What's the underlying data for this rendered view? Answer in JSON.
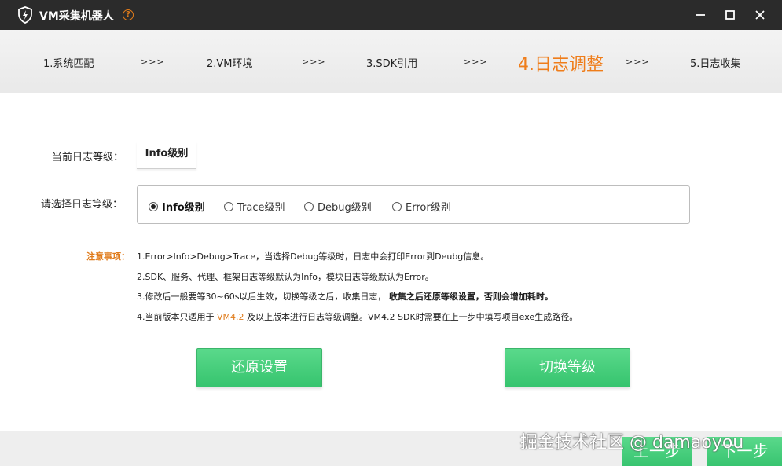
{
  "window": {
    "title": "VM采集机器人",
    "help_icon": "?",
    "icons": [
      "shield-lightning-icon",
      "help-circle-icon",
      "minimize-icon",
      "maximize-icon",
      "close-icon"
    ]
  },
  "steps": [
    {
      "label": "1.系统匹配"
    },
    {
      "label": "2.VM环境"
    },
    {
      "label": "3.SDK引用"
    },
    {
      "label": "4.日志调整"
    },
    {
      "label": "5.日志收集"
    }
  ],
  "step_arrow": ">>>",
  "form": {
    "current_label": "当前日志等级：",
    "current_value": "Info级别",
    "select_label": "请选择日志等级：",
    "options": [
      {
        "label": "Info级别",
        "checked": true
      },
      {
        "label": "Trace级别",
        "checked": false
      },
      {
        "label": "Debug级别",
        "checked": false
      },
      {
        "label": "Error级别",
        "checked": false
      }
    ]
  },
  "notice": {
    "title": "注意事项：",
    "line1": "1.Error>Info>Debug>Trace，当选择Debug等级时，日志中会打印Error到Deubg信息。",
    "line2": "2.SDK、服务、代理、框架日志等级默认为Info，模块日志等级默认为Error。",
    "line3_a": "3.修改后一般要等30~60s以后生效，切换等级之后，收集日志，",
    "line3_b": "收集之后还原等级设置，否则会增加耗时。",
    "line4_a": "4.当前版本只适用于",
    "line4_hl": "VM4.2",
    "line4_b": "及以上版本进行日志等级调整。VM4.2 SDK时需要在上一步中填写项目exe生成路径。"
  },
  "buttons": {
    "restore": "还原设置",
    "switch": "切换等级",
    "prev": "上一步",
    "next": "下一步"
  },
  "watermark": "掘金技术社区 @ damaoyou",
  "colors": {
    "accent": "#ef7d1a",
    "green": "#3ecb76",
    "titlebar": "#2b2b2b"
  }
}
